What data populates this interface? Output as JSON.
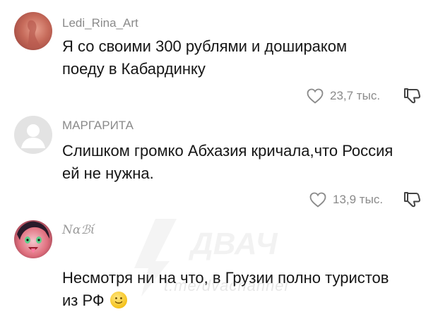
{
  "comments": [
    {
      "username": "Ledi_Rina_Art",
      "text": "Я со своими 300 рублями и дошираком\nпоеду в Кабардинку",
      "likes": "23,7 тыс.",
      "avatar": "photo-avatar"
    },
    {
      "username": "МАРГАРИТА",
      "text": "Слишком громко Абхазия кричала,что Россия\nей не нужна.",
      "likes": "13,9 тыс.",
      "avatar": "default-avatar"
    },
    {
      "username": "Nαℬί",
      "text": "Несмотря ни на что, в Грузии полно туристов\nиз РФ",
      "avatar": "anime-avatar",
      "emoji": "slightly-smiling-face"
    }
  ],
  "watermark": "t.me/dvachannel",
  "colors": {
    "meta": "#8a8a8a",
    "text": "#161616",
    "background": "#ffffff"
  }
}
